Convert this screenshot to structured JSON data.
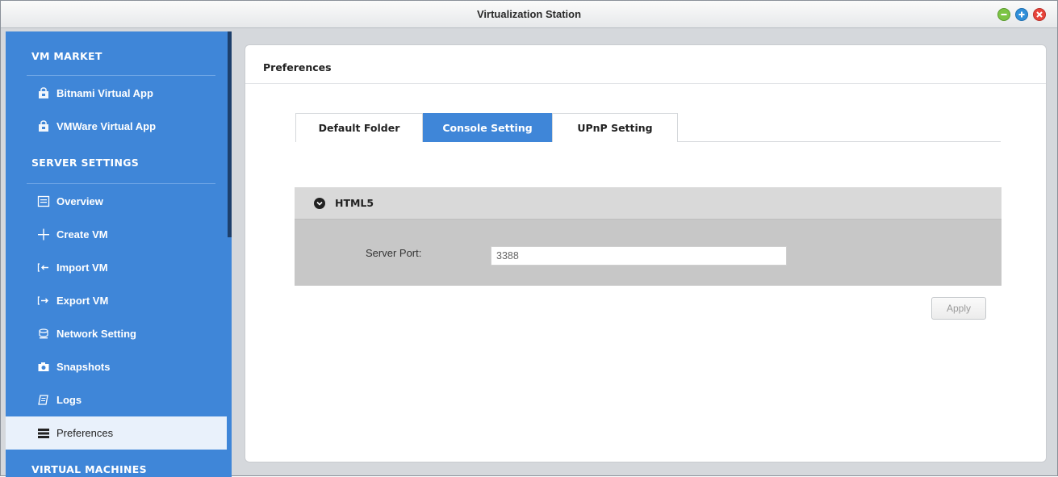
{
  "window": {
    "title": "Virtualization Station",
    "controls": [
      "minimize",
      "maximize",
      "close"
    ]
  },
  "sidebar": {
    "sections": [
      {
        "label": "VM MARKET",
        "items": [
          {
            "label": "Bitnami Virtual App",
            "icon": "store-icon"
          },
          {
            "label": "VMWare Virtual App",
            "icon": "store-icon"
          }
        ]
      },
      {
        "label": "SERVER SETTINGS",
        "items": [
          {
            "label": "Overview",
            "icon": "overview-icon"
          },
          {
            "label": "Create VM",
            "icon": "plus-icon"
          },
          {
            "label": "Import VM",
            "icon": "import-icon"
          },
          {
            "label": "Export VM",
            "icon": "export-icon"
          },
          {
            "label": "Network Setting",
            "icon": "network-icon"
          },
          {
            "label": "Snapshots",
            "icon": "snapshot-icon"
          },
          {
            "label": "Logs",
            "icon": "logs-icon"
          },
          {
            "label": "Preferences",
            "icon": "preferences-icon",
            "active": true
          }
        ]
      },
      {
        "label": "VIRTUAL MACHINES",
        "items": []
      }
    ]
  },
  "main": {
    "title": "Preferences",
    "tabs": [
      {
        "label": "Default Folder",
        "active": false
      },
      {
        "label": "Console Setting",
        "active": true
      },
      {
        "label": "UPnP Setting",
        "active": false
      }
    ],
    "group": {
      "label": "HTML5",
      "expanded": true,
      "fields": [
        {
          "label": "Server Port:",
          "value": "3388"
        }
      ]
    },
    "apply_label": "Apply"
  },
  "colors": {
    "accent": "#3f86d8",
    "sidebar_bg": "#3f86d8",
    "active_item_bg": "#e9f1fb",
    "group_bg": "#c7c7c7"
  }
}
